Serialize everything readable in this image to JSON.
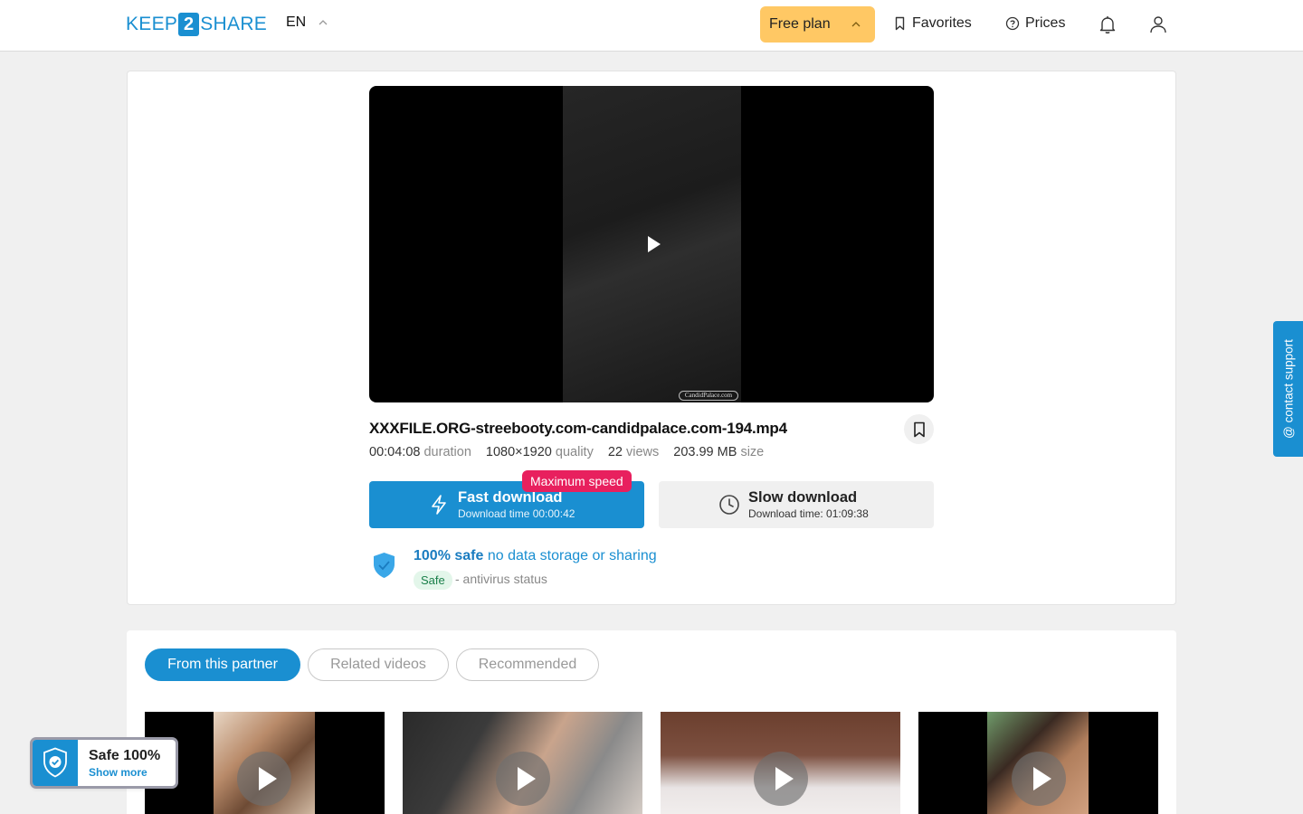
{
  "header": {
    "logo_left": "KEEP",
    "logo_mid": "2",
    "logo_right": "SHARE",
    "language": "EN",
    "plan_label": "Free plan",
    "favorites_label": "Favorites",
    "prices_label": "Prices"
  },
  "file": {
    "name": "XXXFILE.ORG-streebooty.com-candidpalace.com-194.mp4",
    "watermark": "CandidPalace.com",
    "duration_value": "00:04:08",
    "duration_label": "duration",
    "quality_value": "1080×1920",
    "quality_label": "quality",
    "views_value": "22",
    "views_label": "views",
    "size_value": "203.99 MB",
    "size_label": "size"
  },
  "download": {
    "fast_title": "Fast download",
    "fast_time": "Download time 00:00:42",
    "max_speed_badge": "Maximum speed",
    "slow_title": "Slow download",
    "slow_time": "Download time: 01:09:38"
  },
  "safety": {
    "headline_bold": "100% safe",
    "headline_rest": "no data storage or sharing",
    "badge": "Safe",
    "antivirus_text": "- antivirus status"
  },
  "tabs": [
    {
      "label": "From this partner",
      "active": true
    },
    {
      "label": "Related videos",
      "active": false
    },
    {
      "label": "Recommended",
      "active": false
    }
  ],
  "support_label": "@ contact support",
  "safe_widget": {
    "title": "Safe 100%",
    "link": "Show more"
  },
  "colors": {
    "brand_blue": "#1a8fd1",
    "plan_yellow": "#ffc864",
    "badge_pink": "#e8205e"
  }
}
